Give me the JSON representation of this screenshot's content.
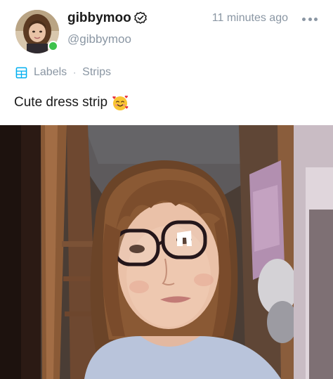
{
  "author": {
    "display_name": "gibbymoo",
    "handle": "@gibbymoo",
    "verified": true,
    "online": true
  },
  "post": {
    "timestamp": "11 minutes ago",
    "labels_label": "Labels",
    "label_separator": "·",
    "label_value": "Strips",
    "caption": "Cute dress strip",
    "caption_emoji": "smiling-face-with-hearts"
  },
  "icons": {
    "verified": "verified-badge-icon",
    "more": "more-options-icon",
    "labels": "labels-icon",
    "online": "online-status-icon"
  },
  "colors": {
    "online": "#3ec24c",
    "muted": "#8a96a3",
    "text": "#1b1b1b",
    "link": "#00aff0"
  }
}
